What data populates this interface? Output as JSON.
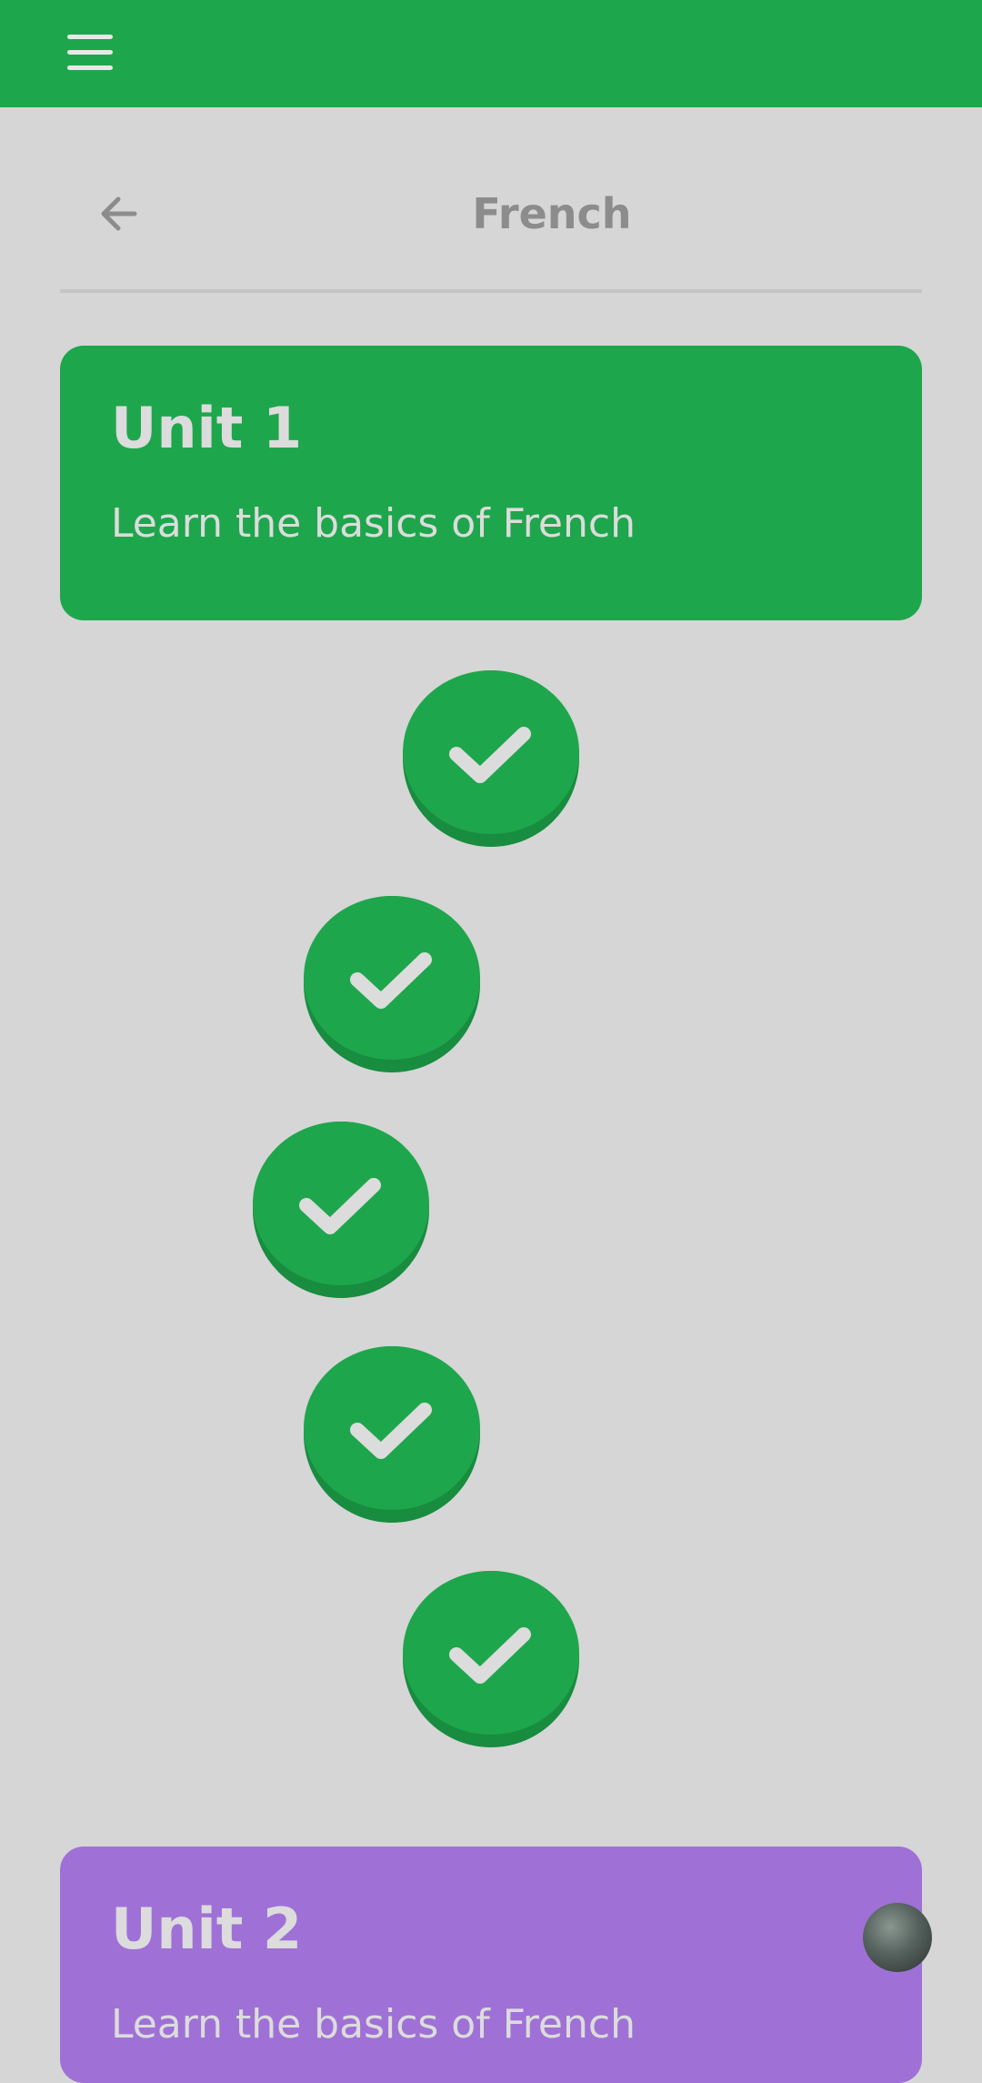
{
  "topbar": {
    "menu_icon": "hamburger-menu-icon",
    "color": "#1ea64c"
  },
  "header": {
    "back_icon": "arrow-left-icon",
    "title": "French"
  },
  "units": [
    {
      "title": "Unit 1",
      "description": "Learn the basics of French",
      "color": "#1ea64c"
    },
    {
      "title": "Unit 2",
      "description": "Learn the basics of French",
      "color": "#9f71d6"
    }
  ],
  "lessons": [
    {
      "status": "completed",
      "icon": "checkmark-icon"
    },
    {
      "status": "completed",
      "icon": "checkmark-icon"
    },
    {
      "status": "completed",
      "icon": "checkmark-icon"
    },
    {
      "status": "completed",
      "icon": "checkmark-icon"
    },
    {
      "status": "completed",
      "icon": "checkmark-icon"
    }
  ],
  "profile": {
    "icon": "avatar-icon"
  }
}
